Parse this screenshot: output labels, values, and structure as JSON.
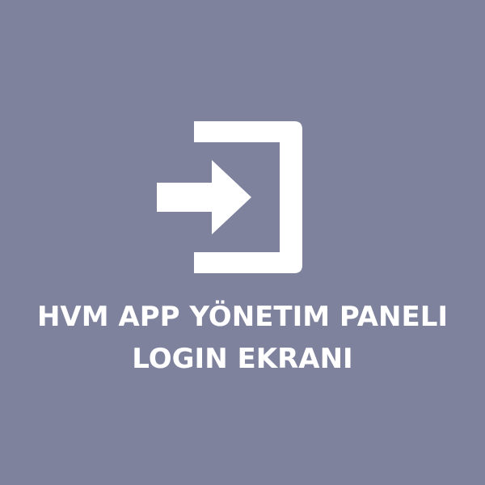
{
  "colors": {
    "background": "#7e829d",
    "foreground": "#ffffff"
  },
  "icon": {
    "name": "login-enter-icon"
  },
  "title": {
    "line1": "HVM APP YÖNETIM PANELI",
    "line2": "LOGIN EKRANI"
  }
}
